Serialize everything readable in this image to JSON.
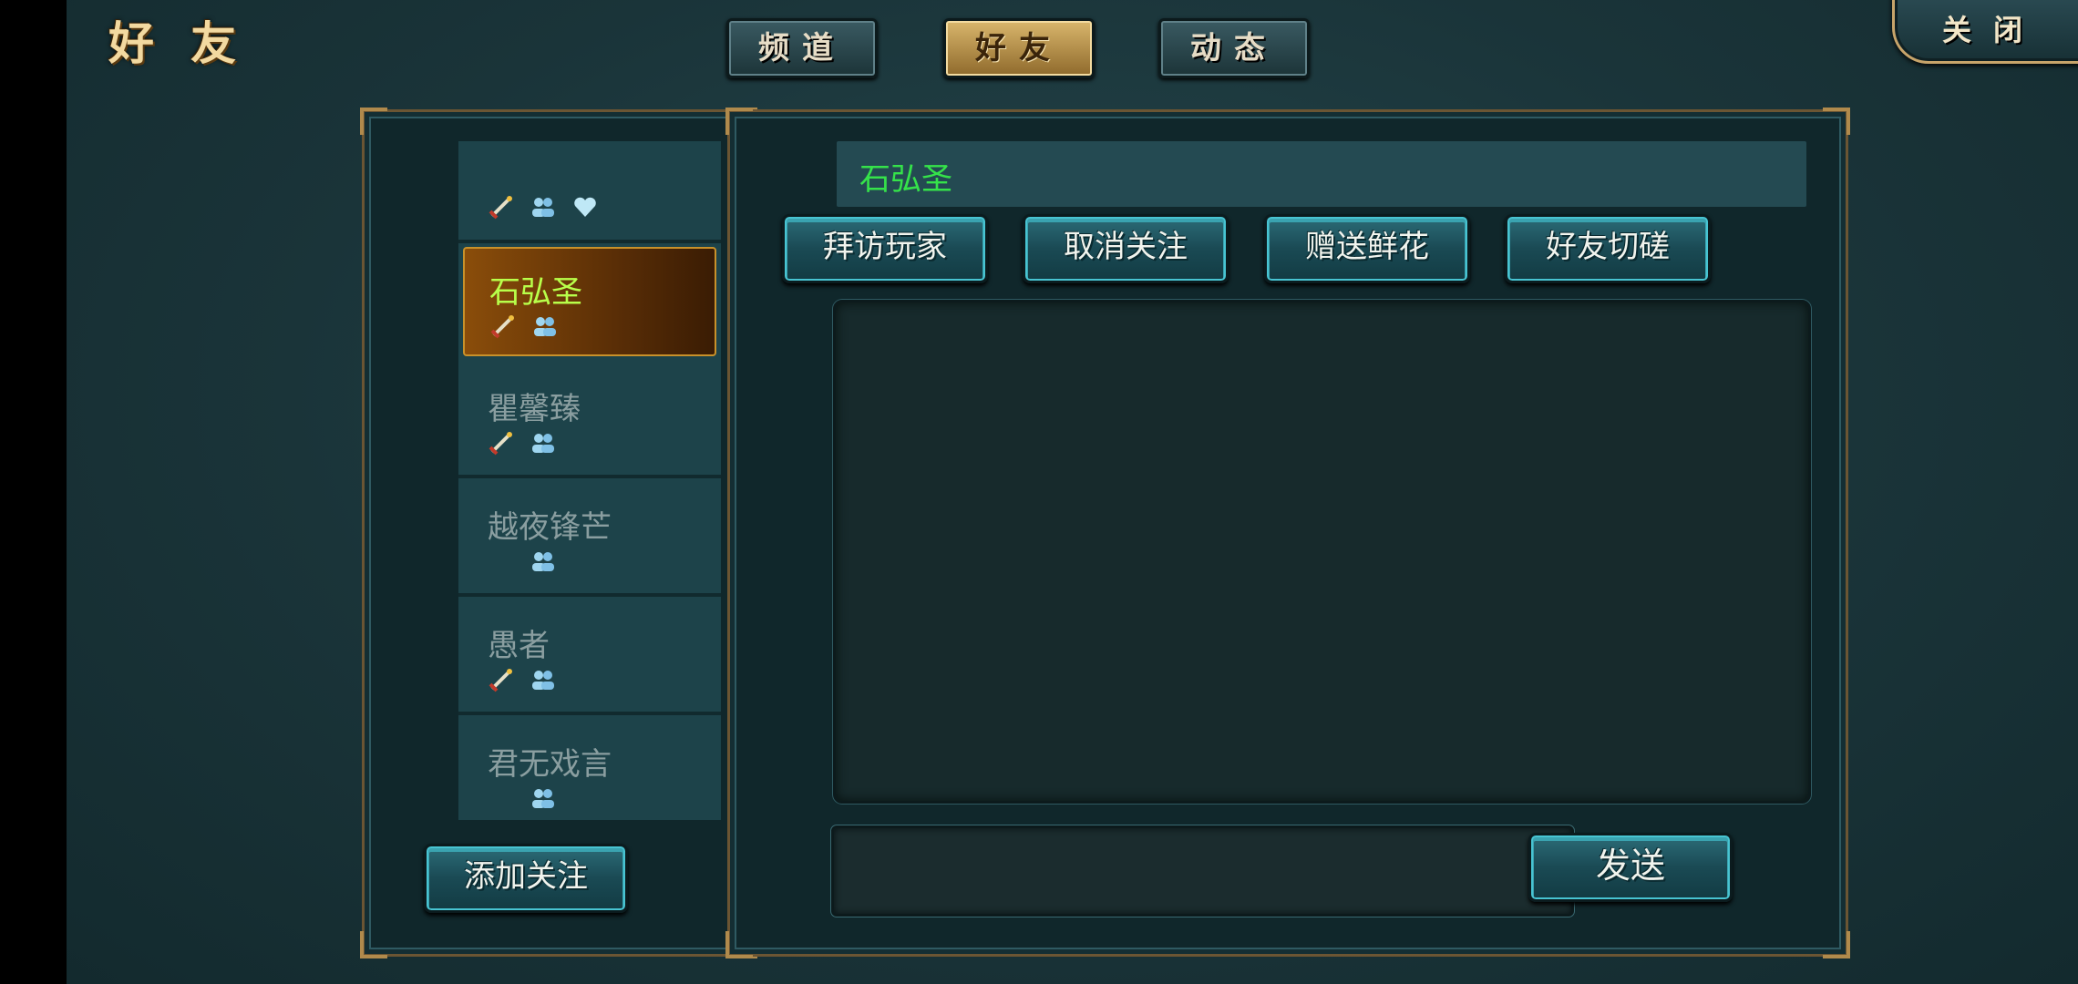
{
  "page_title": "好友",
  "tabs": [
    {
      "label": "频道",
      "active": false
    },
    {
      "label": "好友",
      "active": true
    },
    {
      "label": "动态",
      "active": false
    }
  ],
  "close_label": "关闭",
  "friend_list": {
    "top_entry_icons": [
      "sword-icon",
      "team-icon",
      "heart-icon"
    ],
    "items": [
      {
        "name": "石弘圣",
        "selected": true,
        "icons": [
          "sword-icon",
          "team-icon"
        ]
      },
      {
        "name": "瞿馨臻",
        "selected": false,
        "icons": [
          "sword-icon",
          "team-icon"
        ]
      },
      {
        "name": "越夜锋芒",
        "selected": false,
        "icons": [
          "team-icon"
        ]
      },
      {
        "name": "愚者",
        "selected": false,
        "icons": [
          "sword-icon",
          "team-icon"
        ]
      },
      {
        "name": "君无戏言",
        "selected": false,
        "icons": [
          "team-icon"
        ]
      }
    ],
    "add_follow_label": "添加关注"
  },
  "detail": {
    "selected_name": "石弘圣",
    "actions": [
      "拜访玩家",
      "取消关注",
      "赠送鲜花",
      "好友切磋"
    ],
    "message_input_value": "",
    "send_label": "发送"
  },
  "colors": {
    "selected_name": "#35e24a",
    "selected_list_name": "#b8ff4a",
    "gold_trim": "#b08a4c",
    "button_teal": "#1a4a54"
  }
}
